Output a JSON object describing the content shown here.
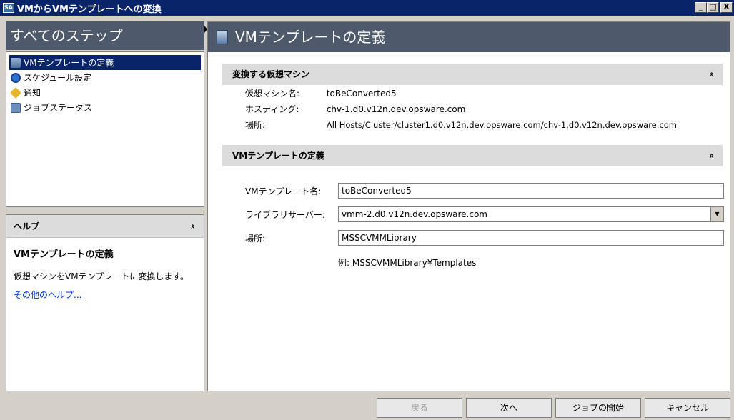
{
  "window": {
    "title": "VMからVMテンプレートへの変換",
    "app_icon": "SA",
    "minimize": "_",
    "maximize": "□",
    "close": "X"
  },
  "steps": {
    "header": "すべてのステップ",
    "items": [
      {
        "label": "VMテンプレートの定義",
        "icon": "template-icon"
      },
      {
        "label": "スケジュール設定",
        "icon": "clock-icon"
      },
      {
        "label": "通知",
        "icon": "notify-icon"
      },
      {
        "label": "ジョブステータス",
        "icon": "status-icon"
      }
    ]
  },
  "help": {
    "header": "ヘルプ",
    "chevron": "«",
    "title": "VMテンプレートの定義",
    "text": "仮想マシンをVMテンプレートに変換します。",
    "link": "その他のヘルプ..."
  },
  "main": {
    "header": "VMテンプレートの定義",
    "section1": {
      "title": "変換する仮想マシン",
      "chevron": "«",
      "rows": [
        {
          "label": "仮想マシン名:",
          "value": "toBeConverted5"
        },
        {
          "label": "ホスティング:",
          "value": "chv-1.d0.v12n.dev.opsware.com"
        },
        {
          "label": "場所:",
          "value": "All Hosts/Cluster/cluster1.d0.v12n.dev.opsware.com/chv-1.d0.v12n.dev.opsware.com"
        }
      ]
    },
    "section2": {
      "title": "VMテンプレートの定義",
      "chevron": "«",
      "template_name_label": "VMテンプレート名:",
      "template_name_value": "toBeConverted5",
      "library_server_label": "ライブラリサーバー:",
      "library_server_value": "vmm-2.d0.v12n.dev.opsware.com",
      "location_label": "場所:",
      "location_value": "MSSCVMMLibrary",
      "example": "例: MSSCVMMLibrary¥Templates"
    }
  },
  "buttons": {
    "back": "戻る",
    "next": "次へ",
    "start_job": "ジョブの開始",
    "cancel": "キャンセル"
  }
}
